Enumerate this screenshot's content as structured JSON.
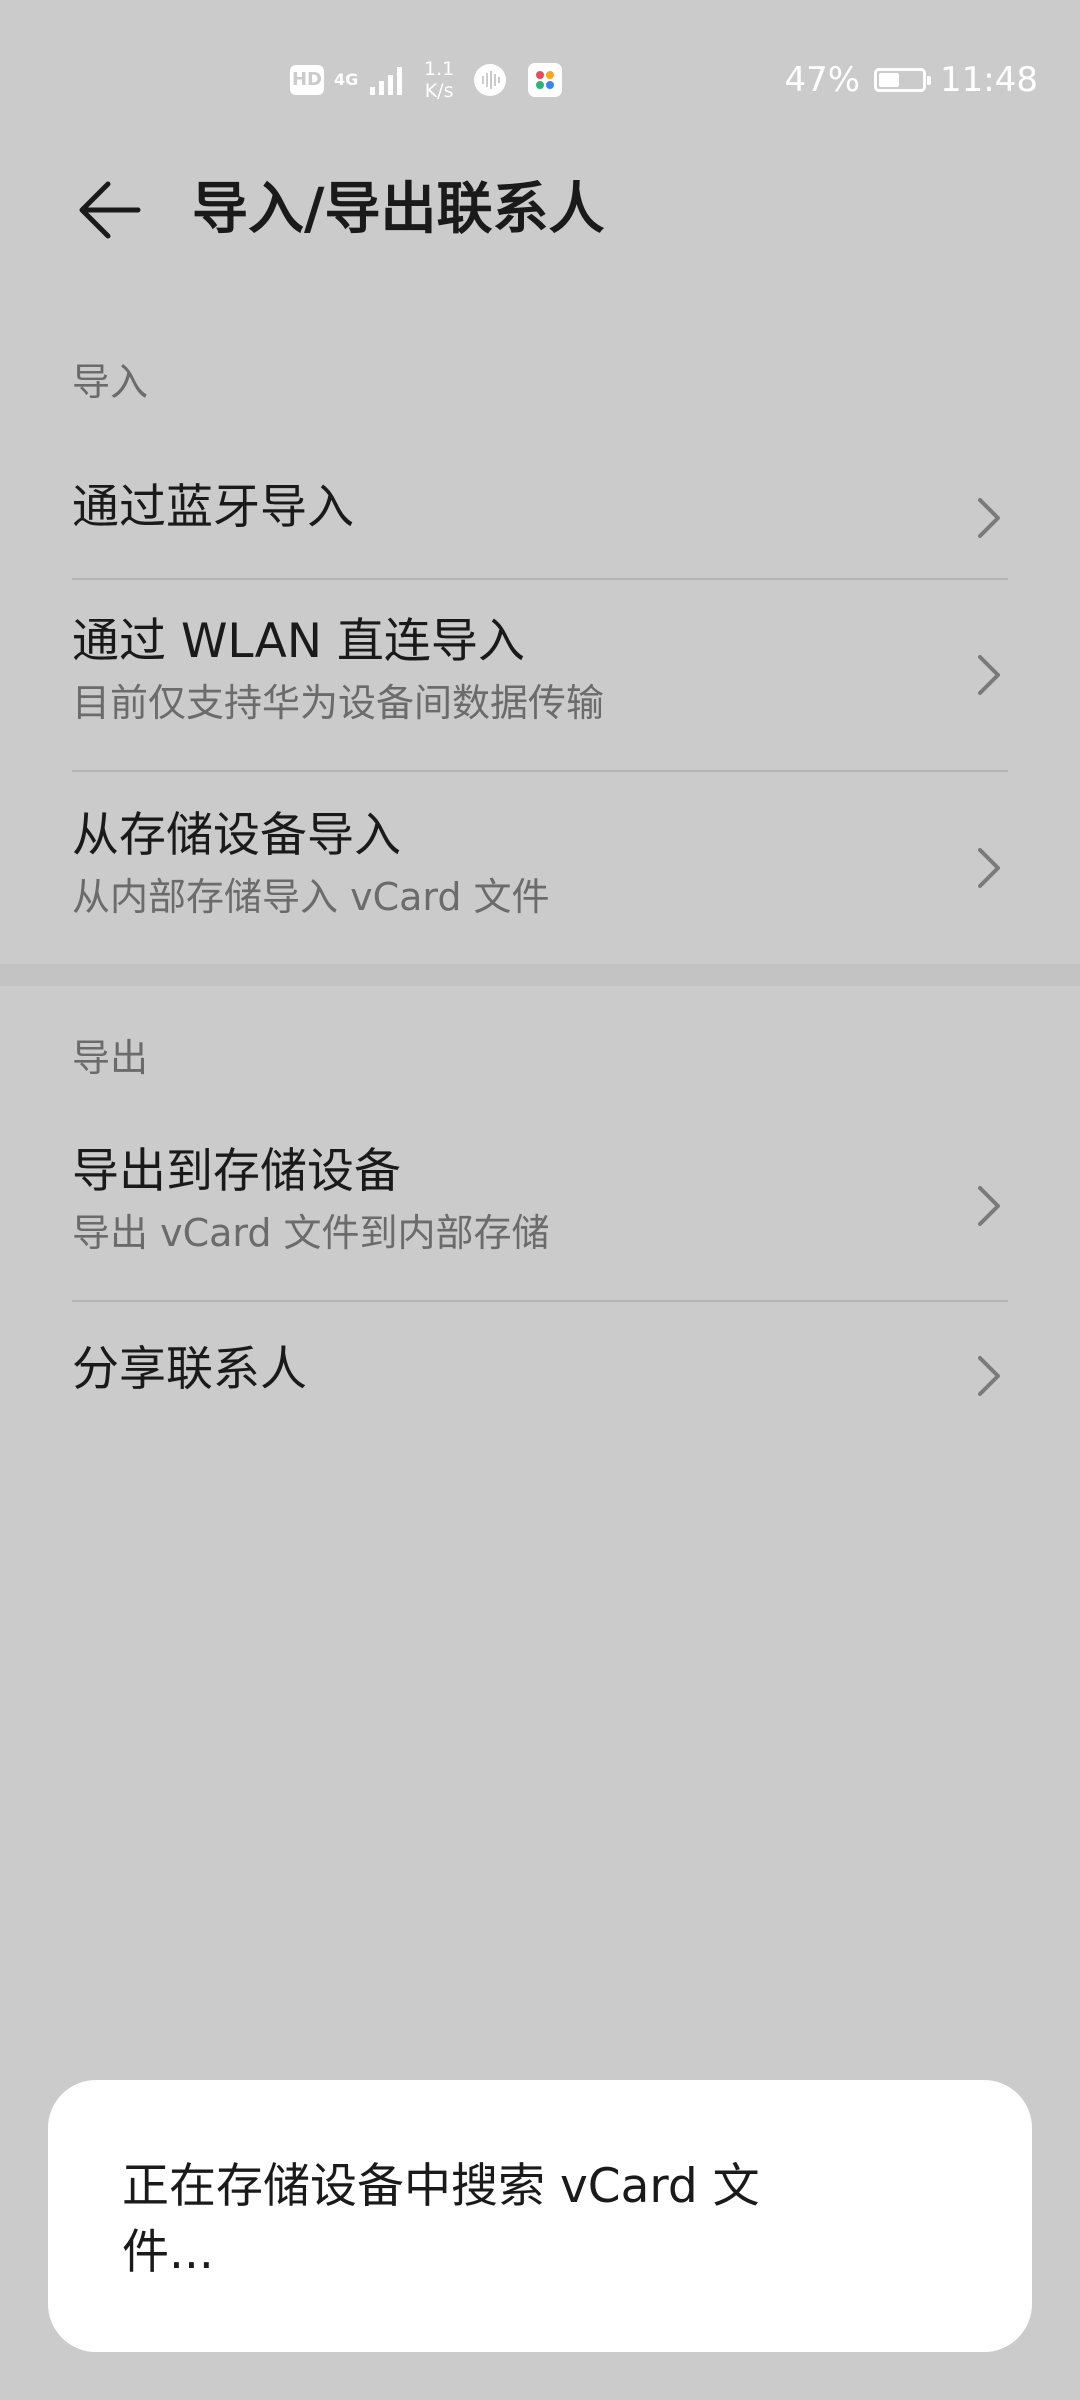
{
  "status_bar": {
    "hd": "HD",
    "network": "4G",
    "speed_value": "1.1",
    "speed_unit": "K/s",
    "battery_percent": "47%",
    "battery_level": 0.47,
    "time": "11:48"
  },
  "header": {
    "title": "导入/导出联系人"
  },
  "import_section": {
    "label": "导入",
    "items": [
      {
        "title": "通过蓝牙导入",
        "subtitle": ""
      },
      {
        "title": "通过 WLAN 直连导入",
        "subtitle": "目前仅支持华为设备间数据传输"
      },
      {
        "title": "从存储设备导入",
        "subtitle": "从内部存储导入 vCard 文件"
      }
    ]
  },
  "export_section": {
    "label": "导出",
    "items": [
      {
        "title": "导出到存储设备",
        "subtitle": "导出 vCard 文件到内部存储"
      },
      {
        "title": "分享联系人",
        "subtitle": ""
      }
    ]
  },
  "toast": {
    "message": "正在存储设备中搜索 vCard 文件..."
  },
  "colors": {
    "background": "#cbcbcb",
    "text_primary": "#1a1a1a",
    "text_secondary": "#6b6b6b",
    "toast_background": "#ffffff"
  },
  "icons": {
    "back": "arrow-left-icon",
    "chevron": "chevron-right-icon",
    "signal": "signal-bars-icon",
    "battery": "battery-charging-icon"
  }
}
